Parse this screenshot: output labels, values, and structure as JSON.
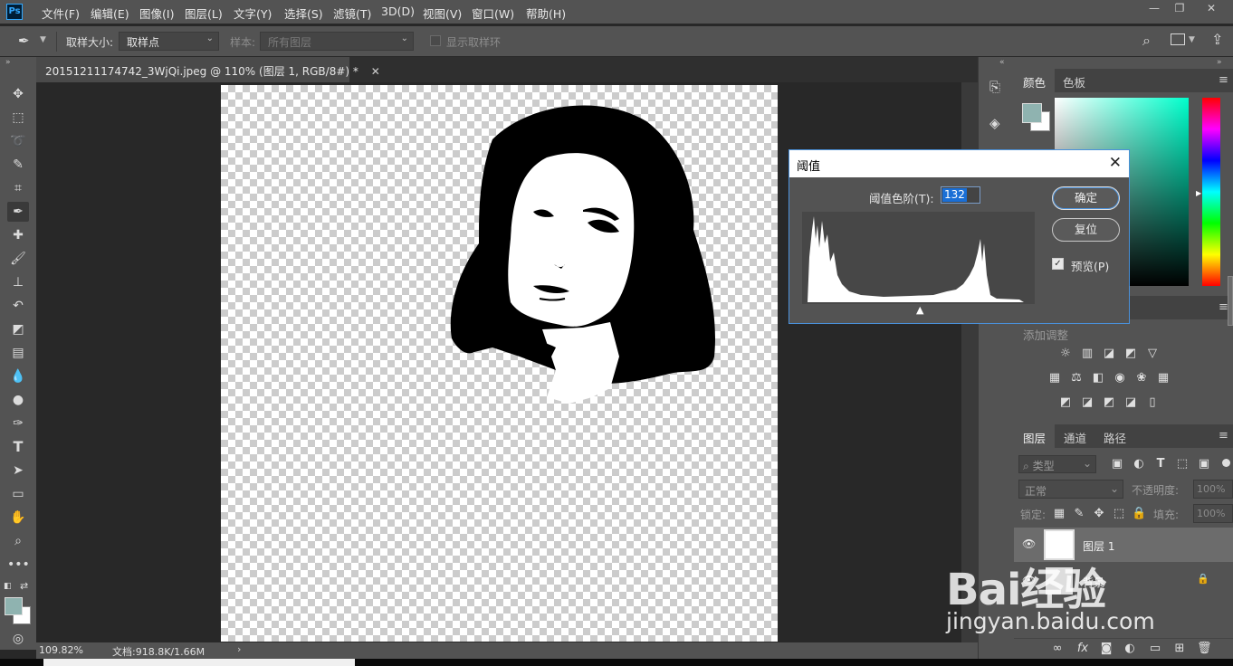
{
  "app": {
    "logo": "Ps"
  },
  "menu": [
    "文件(F)",
    "编辑(E)",
    "图像(I)",
    "图层(L)",
    "文字(Y)",
    "选择(S)",
    "滤镜(T)",
    "3D(D)",
    "视图(V)",
    "窗口(W)",
    "帮助(H)"
  ],
  "options": {
    "sample_size_label": "取样大小:",
    "sample_size_value": "取样点",
    "sample_label": "样本:",
    "sample_value": "所有图层",
    "show_ring_label": "显示取样环"
  },
  "document": {
    "tab_title": "20151211174742_3WjQi.jpeg @ 110% (图层 1, RGB/8#) *"
  },
  "status": {
    "zoom": "109.82%",
    "doc_info": "文档:918.8K/1.66M"
  },
  "color_panel": {
    "tabs": [
      "颜色",
      "色板"
    ],
    "foreground": "#8fb3b0",
    "background": "#ffffff"
  },
  "adjustments": {
    "title": "添加调整"
  },
  "layers_panel": {
    "tabs": [
      "图层",
      "通道",
      "路径"
    ],
    "filter_label": "类型",
    "blend_mode": "正常",
    "opacity_label": "不透明度:",
    "opacity_value": "100%",
    "lock_label": "锁定:",
    "fill_label": "填充:",
    "fill_value": "100%",
    "layers": [
      {
        "name": "图层 1",
        "selected": true,
        "visible": true
      },
      {
        "name": "背景",
        "selected": false,
        "visible": true,
        "locked": true
      }
    ]
  },
  "dialog": {
    "title": "阈值",
    "level_label": "阈值色阶(T):",
    "level_value": "132",
    "ok_label": "确定",
    "reset_label": "复位",
    "preview_label": "预览(P)",
    "preview_checked": true
  },
  "watermark": {
    "brand": "Bai经验",
    "url": "jingyan.baidu.com"
  }
}
